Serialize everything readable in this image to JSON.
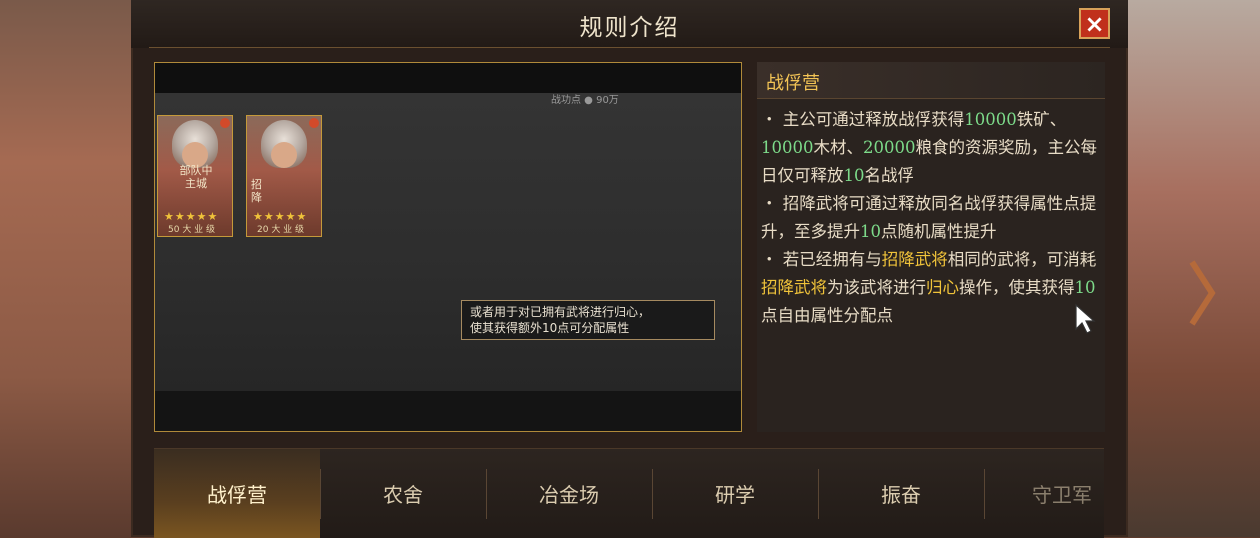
{
  "title": "规则介绍",
  "close_icon": "×",
  "video": {
    "top_text": "战功点 ● 90万",
    "cards": [
      {
        "tag": "部队中\n主城",
        "stars": "★★★★★",
        "level": "50 大 业 级"
      },
      {
        "tag": "招\n降",
        "stars": "★★★★★",
        "level": "20 大 业 级"
      }
    ],
    "tooltip": {
      "line1": "或者用于对已拥有武将进行归心，",
      "line2": "使其获得额外10点可分配属性"
    }
  },
  "rules": {
    "heading": "战俘营",
    "items": [
      {
        "parts": [
          {
            "t": "・ 主公可通过释放战俘获得",
            "c": ""
          },
          {
            "t": "10000",
            "c": "num"
          },
          {
            "t": "铁矿、",
            "c": ""
          },
          {
            "t": "10000",
            "c": "num"
          },
          {
            "t": "木材、",
            "c": ""
          },
          {
            "t": "20000",
            "c": "num"
          },
          {
            "t": "粮食的资源奖励，主公每日仅可释放",
            "c": ""
          },
          {
            "t": "10",
            "c": "num"
          },
          {
            "t": "名战俘",
            "c": ""
          }
        ]
      },
      {
        "parts": [
          {
            "t": "・ 招降武将可通过释放同名战俘获得属性点提升，至多提升",
            "c": ""
          },
          {
            "t": "10",
            "c": "num"
          },
          {
            "t": "点随机属性提升",
            "c": ""
          }
        ]
      },
      {
        "parts": [
          {
            "t": "・ 若已经拥有与",
            "c": ""
          },
          {
            "t": "招降武将",
            "c": "gold"
          },
          {
            "t": "相同的武将，可消耗",
            "c": ""
          },
          {
            "t": "招降武将",
            "c": "gold"
          },
          {
            "t": "为该武将进行",
            "c": ""
          },
          {
            "t": "归心",
            "c": "gold"
          },
          {
            "t": "操作，使其获得",
            "c": ""
          },
          {
            "t": "10",
            "c": "num"
          },
          {
            "t": "点自由属性分配点",
            "c": ""
          }
        ]
      }
    ]
  },
  "tabs": [
    "战俘营",
    "农舍",
    "冶金场",
    "研学",
    "振奋",
    "守卫军"
  ],
  "active_tab": 0,
  "colors": {
    "number": "#7ddb8a",
    "highlight": "#f0c33a",
    "heading": "#f3c455"
  }
}
